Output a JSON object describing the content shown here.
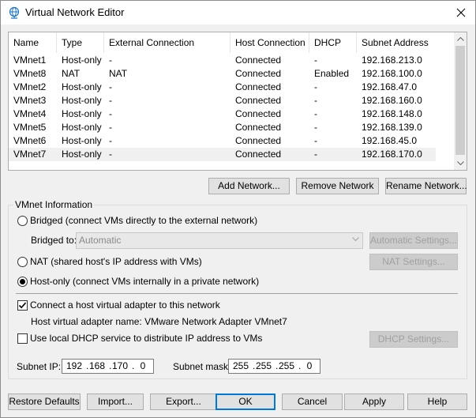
{
  "window": {
    "title": "Virtual Network Editor"
  },
  "networks": {
    "columns": [
      "Name",
      "Type",
      "External Connection",
      "Host Connection",
      "DHCP",
      "Subnet Address"
    ],
    "rows": [
      [
        "VMnet1",
        "Host-only",
        "-",
        "Connected",
        "-",
        "192.168.213.0"
      ],
      [
        "VMnet8",
        "NAT",
        "NAT",
        "Connected",
        "Enabled",
        "192.168.100.0"
      ],
      [
        "VMnet2",
        "Host-only",
        "-",
        "Connected",
        "-",
        "192.168.47.0"
      ],
      [
        "VMnet3",
        "Host-only",
        "-",
        "Connected",
        "-",
        "192.168.160.0"
      ],
      [
        "VMnet4",
        "Host-only",
        "-",
        "Connected",
        "-",
        "192.168.148.0"
      ],
      [
        "VMnet5",
        "Host-only",
        "-",
        "Connected",
        "-",
        "192.168.139.0"
      ],
      [
        "VMnet6",
        "Host-only",
        "-",
        "Connected",
        "-",
        "192.168.45.0"
      ],
      [
        "VMnet7",
        "Host-only",
        "-",
        "Connected",
        "-",
        "192.168.170.0"
      ]
    ],
    "selected_row": "VMnet7"
  },
  "network_buttons": {
    "add": "Add Network...",
    "remove": "Remove Network",
    "rename": "Rename Network..."
  },
  "vmnet_info": {
    "group_label": "VMnet Information",
    "bridged_label": "Bridged (connect VMs directly to the external network)",
    "bridged_to_label": "Bridged to:",
    "bridged_to_value": "Automatic",
    "auto_settings": "Automatic Settings...",
    "nat_label": "NAT (shared host's IP address with VMs)",
    "nat_settings": "NAT Settings...",
    "hostonly_label": "Host-only (connect VMs internally in a private network)",
    "selected_mode": "host-only",
    "connect_adapter_label": "Connect a host virtual adapter to this network",
    "connect_adapter_checked": true,
    "adapter_name_label": "Host virtual adapter name: VMware Network Adapter VMnet7",
    "dhcp_label": "Use local DHCP service to distribute IP address to VMs",
    "dhcp_checked": false,
    "dhcp_settings": "DHCP Settings...",
    "subnet_ip_label": "Subnet IP:",
    "subnet_ip": [
      "192",
      "168",
      "170",
      "0"
    ],
    "subnet_mask_label": "Subnet mask:",
    "subnet_mask": [
      "255",
      "255",
      "255",
      "0"
    ]
  },
  "footer": {
    "restore": "Restore Defaults",
    "import": "Import...",
    "export": "Export...",
    "ok": "OK",
    "cancel": "Cancel",
    "apply": "Apply",
    "help": "Help"
  },
  "colors": {
    "selection": "#f0f0f0",
    "default_button_border": "#0078d7"
  },
  "icons": {
    "title": "globe-network-icon",
    "close": "close-icon"
  }
}
